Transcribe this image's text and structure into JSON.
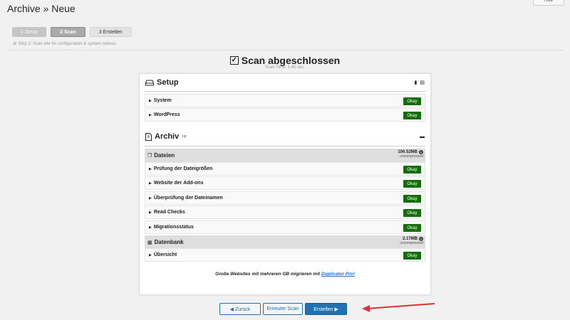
{
  "page": {
    "title": "Archive » Neue",
    "help_label": "Hilfe"
  },
  "steps": {
    "items": [
      {
        "label": "1 Setup"
      },
      {
        "label": "2 Scan"
      },
      {
        "label": "3 Erstellen"
      }
    ],
    "note": "Step 2: Scan site for configuration & system notices."
  },
  "scan": {
    "title": "Scan abgeschlossen",
    "time": "Scan Time: 1.60 sec."
  },
  "setup": {
    "title": "Setup",
    "rows": [
      {
        "label": "System",
        "status": "Okay"
      },
      {
        "label": "WordPress",
        "status": "Okay"
      }
    ]
  },
  "archiv": {
    "title": "Archiv",
    "superscript": "zip",
    "dateien": {
      "title": "Dateien",
      "size": "106.52MB",
      "size_note": "uncompressed",
      "rows": [
        {
          "label": "Prüfung der Dateigrößen",
          "status": "Okay"
        },
        {
          "label": "Website der Add-ons",
          "status": "Okay"
        },
        {
          "label": "Überprüfung der Dateinamen",
          "status": "Okay"
        },
        {
          "label": "Read Checks",
          "status": "Okay"
        },
        {
          "label": "Migrationsstatus",
          "status": "Okay"
        }
      ]
    },
    "datenbank": {
      "title": "Datenbank",
      "size": "2.17MB",
      "size_note": "uncompressed",
      "rows": [
        {
          "label": "Übersicht",
          "status": "Okay"
        }
      ]
    }
  },
  "promo": {
    "text": "Große Websites mit mehreren GB migrieren mit",
    "link": "Duplicator Pro!"
  },
  "buttons": {
    "back": "◀ Zurück",
    "rescan": "Erneuter Scan",
    "build": "Erstellen ▶"
  },
  "colors": {
    "okay": "#136d09",
    "primary": "#2271b1",
    "arrow": "#d9323b"
  }
}
